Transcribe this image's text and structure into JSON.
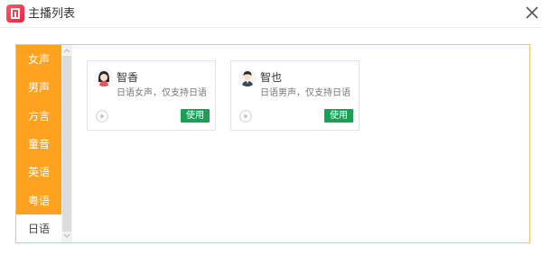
{
  "window": {
    "title": "主播列表",
    "logo_icon": "app-logo-icon",
    "close_icon": "close-icon"
  },
  "colors": {
    "accent": "#ffa21f",
    "panel_border": "#f3c56b",
    "use_button": "#1a9f54"
  },
  "categories": {
    "items": [
      {
        "label": "女声"
      },
      {
        "label": "男声"
      },
      {
        "label": "方言"
      },
      {
        "label": "童音"
      },
      {
        "label": "英语"
      },
      {
        "label": "粤语"
      },
      {
        "label": "日语"
      }
    ],
    "selected": "日语"
  },
  "voices": [
    {
      "name": "智香",
      "desc": "日语女声，仅支持日语",
      "use_label": "使用",
      "avatar": "female-avatar-icon",
      "play_icon": "play-icon"
    },
    {
      "name": "智也",
      "desc": "日语男声，仅支持日语",
      "use_label": "使用",
      "avatar": "male-avatar-icon",
      "play_icon": "play-icon"
    }
  ]
}
